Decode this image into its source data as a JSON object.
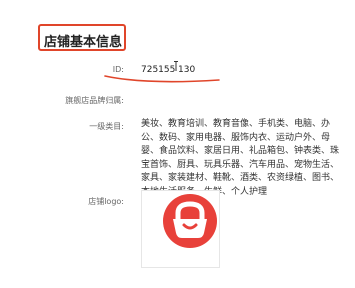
{
  "section": {
    "title": "店铺基本信息"
  },
  "fields": {
    "id_label": "ID:",
    "id_value_main": "725155",
    "id_value_tail": "130",
    "brand_label": "旗舰店品牌归属:",
    "category_label": "一级类目:",
    "category_value": "美妆、教育培训、教育音像、手机类、电脑、办公、数码、家用电器、服饰内衣、运动户外、母婴、食品饮料、家居日用、礼品箱包、钟表类、珠宝首饰、厨具、玩具乐器、汽车用品、宠物生活、家具、家装建材、鞋靴、酒类、农资绿植、图书、本地生活服务、生鲜、个人护理",
    "logo_label": "店铺logo:"
  },
  "colors": {
    "accent": "#e0452a",
    "logo_red": "#e8413a"
  },
  "icons": {
    "logo": "shopping-basket-logo"
  }
}
